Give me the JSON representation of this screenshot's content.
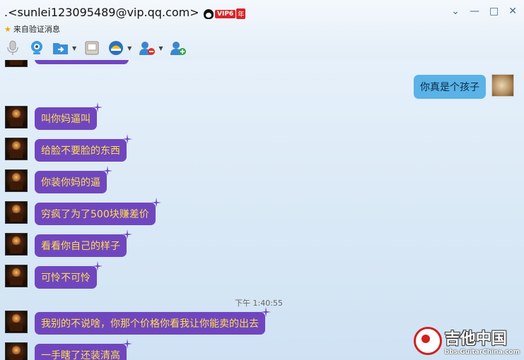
{
  "window": {
    "title": ".<sunlei123095489@vip.qq.com>",
    "vip_label": "VIP6",
    "vip_year": "年",
    "subtitle": "来自验证消息",
    "controls": [
      "⌄",
      "—",
      "□",
      "✕"
    ]
  },
  "toolbar": {
    "items": [
      "microphone-icon",
      "video-icon",
      "file-transfer-icon",
      "screen-icon",
      "app-icon",
      "remove-contact-icon",
      "add-contact-icon"
    ]
  },
  "chat": {
    "right_message": "你真是个孩子",
    "left_messages": [
      "叫你妈逼叫",
      "给脸不要脸的东西",
      "你装你妈的逼",
      "穷疯了为了500块赚差价",
      "看看你自己的样子",
      "可怜不可怜"
    ],
    "timestamp": "下午 1:40:55",
    "after_messages": [
      "我别的不说啥，你那个价格你看我让你能卖的出去",
      "一手瞎了还装清高"
    ]
  },
  "watermark": {
    "name": "吉他中国",
    "url": "bbs.GuitarChina.com"
  },
  "colors": {
    "bubble_left": "#7046bf",
    "bubble_text": "#ffdf4c",
    "bubble_right": "#5ab2e6"
  }
}
